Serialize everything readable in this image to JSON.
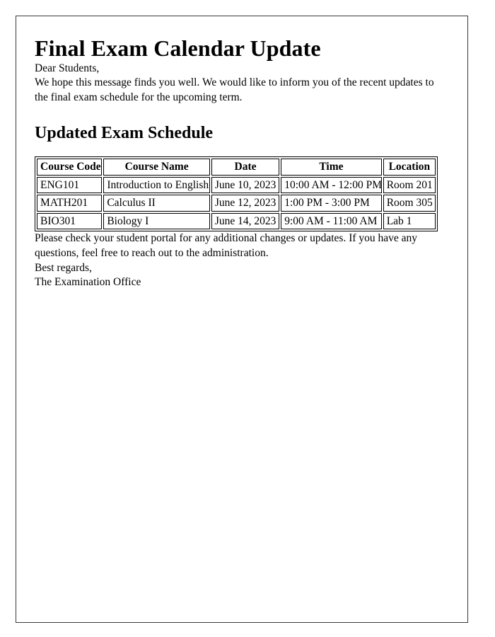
{
  "document": {
    "title": "Final Exam Calendar Update",
    "salutation": "Dear Students,",
    "intro_paragraph": "We hope this message finds you well. We would like to inform you of the recent updates to the final exam schedule for the upcoming term.",
    "section_heading": "Updated Exam Schedule",
    "closing_paragraph": "Please check your student portal for any additional changes or updates. If you have any questions, feel free to reach out to the administration.",
    "sign_off": "Best regards,",
    "signature": "The Examination Office"
  },
  "schedule_table": {
    "columns": [
      "Course Code",
      "Course Name",
      "Date",
      "Time",
      "Location"
    ],
    "rows": [
      {
        "course_code": "ENG101",
        "course_name": "Introduction to English",
        "date": "June 10, 2023",
        "time": "10:00 AM - 12:00 PM",
        "location": "Room 201"
      },
      {
        "course_code": "MATH201",
        "course_name": "Calculus II",
        "date": "June 12, 2023",
        "time": "1:00 PM - 3:00 PM",
        "location": "Room 305"
      },
      {
        "course_code": "BIO301",
        "course_name": "Biology I",
        "date": "June 14, 2023",
        "time": "9:00 AM - 11:00 AM",
        "location": "Lab 1"
      }
    ]
  },
  "theme": {
    "page_background": "#ffffff",
    "text_color": "#000000",
    "border_color": "#000000",
    "frame_border_color": "#3a3a3a"
  }
}
